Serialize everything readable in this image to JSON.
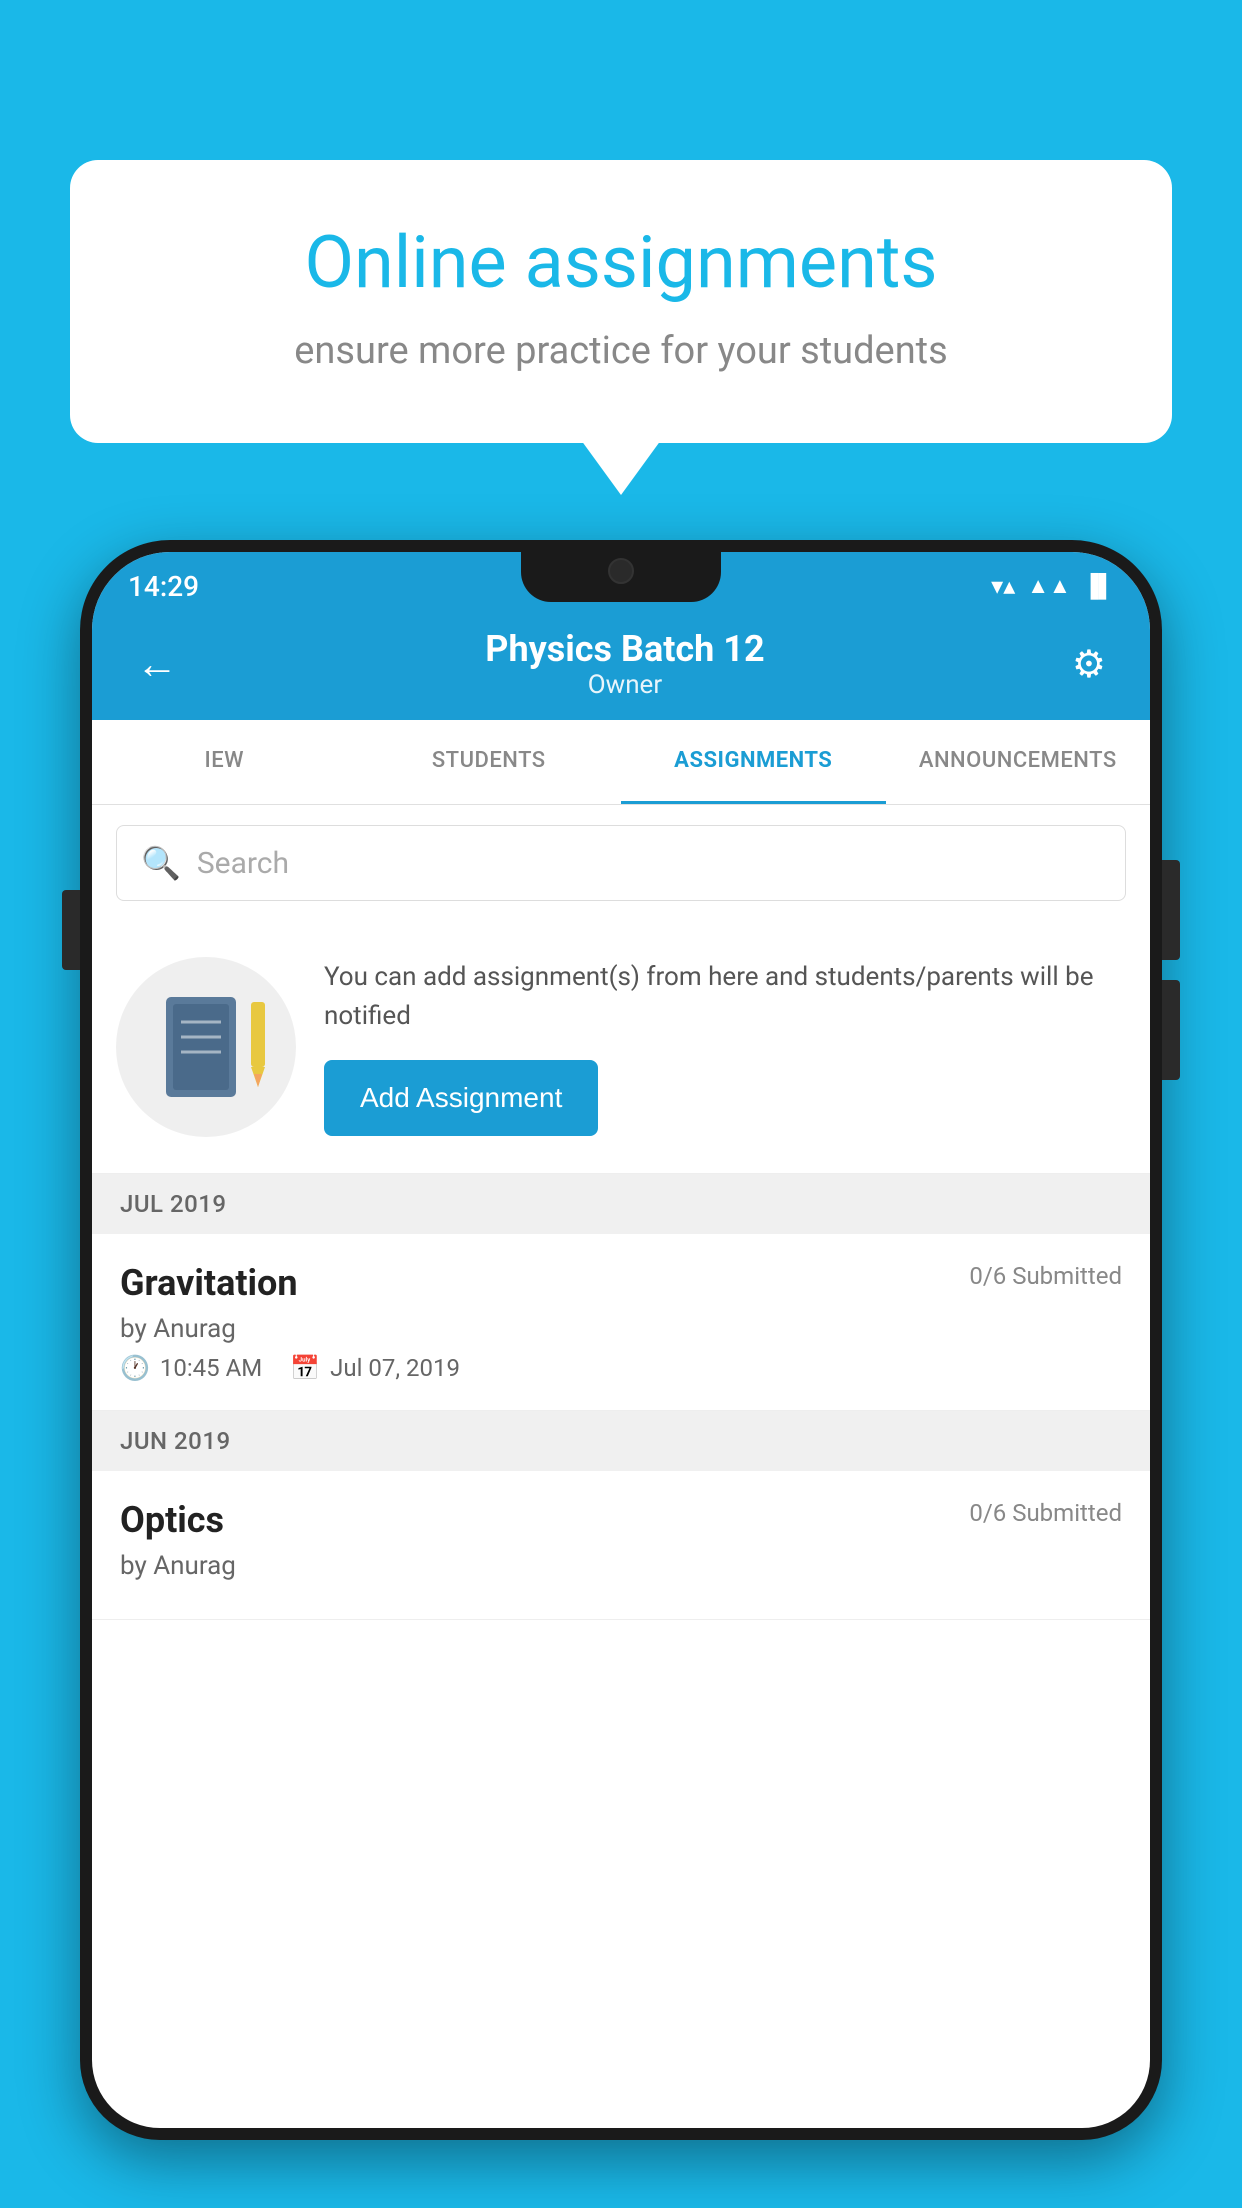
{
  "bubble": {
    "title": "Online assignments",
    "subtitle": "ensure more practice for your students"
  },
  "status_bar": {
    "time": "14:29",
    "wifi": "▼",
    "signal": "▲",
    "battery": "▮"
  },
  "header": {
    "title": "Physics Batch 12",
    "subtitle": "Owner",
    "back_label": "←",
    "settings_label": "⚙"
  },
  "tabs": [
    {
      "label": "IEW",
      "active": false
    },
    {
      "label": "STUDENTS",
      "active": false
    },
    {
      "label": "ASSIGNMENTS",
      "active": true
    },
    {
      "label": "ANNOUNCEMENTS",
      "active": false
    }
  ],
  "search": {
    "placeholder": "Search"
  },
  "promo": {
    "text": "You can add assignment(s) from here and students/parents will be notified",
    "button_label": "Add Assignment"
  },
  "sections": [
    {
      "month": "JUL 2019",
      "assignments": [
        {
          "name": "Gravitation",
          "submitted": "0/6 Submitted",
          "by": "by Anurag",
          "time": "10:45 AM",
          "date": "Jul 07, 2019"
        }
      ]
    },
    {
      "month": "JUN 2019",
      "assignments": [
        {
          "name": "Optics",
          "submitted": "0/6 Submitted",
          "by": "by Anurag",
          "time": "",
          "date": ""
        }
      ]
    }
  ]
}
